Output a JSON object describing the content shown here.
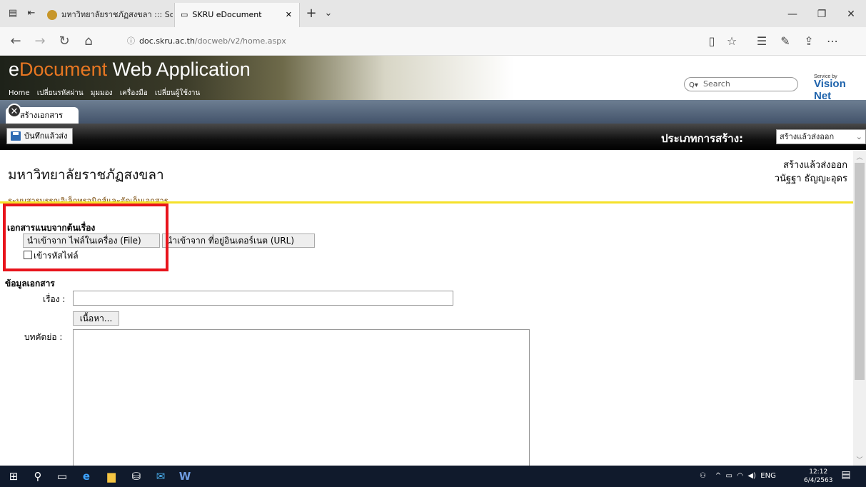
{
  "browser": {
    "tabs": [
      {
        "title": "มหาวิทยาลัยราชภัฏสงขลา ::: So"
      },
      {
        "title": "SKRU eDocument"
      }
    ],
    "url": {
      "domain": "doc.skru.ac.th",
      "path": "/docweb/v2/home.aspx"
    }
  },
  "banner": {
    "title_prefix": "e",
    "title_em": "Document",
    "title_rest": " Web Application",
    "menu": [
      "Home",
      "เปลี่ยนรหัสผ่าน",
      "มุมมอง",
      "เครื่องมือ",
      "เปลี่ยนผู้ใช้งาน"
    ],
    "search_placeholder": "Search",
    "service_by": "Service by",
    "vendor": "Vision Net"
  },
  "doc_tab": {
    "label": "สร้างเอกสาร"
  },
  "toolbar": {
    "save_label": "บันทึกแล้วส่ง",
    "type_label": "ประเภทการสร้าง:",
    "type_value": "สร้างแล้วส่งออก"
  },
  "content": {
    "org_title": "มหาวิทยาลัยราชภัฏสงขลา",
    "org_subtitle": "ระบบสารบรรณอิเล็กทรอนิกส์และจัดเก็บเอกสาร",
    "status": "สร้างแล้วส่งออก",
    "user": "วนัฐฐา ธัญญะอุดร",
    "attach_heading": "เอกสารแนบจากต้นเรื่อง",
    "import_file": "นำเข้าจาก ไฟล์ในเครื่อง (File)",
    "import_url": "นำเข้าจาก ที่อยู่อินเตอร์เนต (URL)",
    "encrypt_label": "เข้ารหัสไฟล์",
    "info_heading": "ข้อมูลเอกสาร",
    "subject_label": "เรื่อง :",
    "content_button": "เนื้อหา...",
    "abstract_label": "บทคัดย่อ :"
  },
  "taskbar": {
    "lang": "ENG",
    "time": "12:12",
    "date": "6/4/2563"
  }
}
